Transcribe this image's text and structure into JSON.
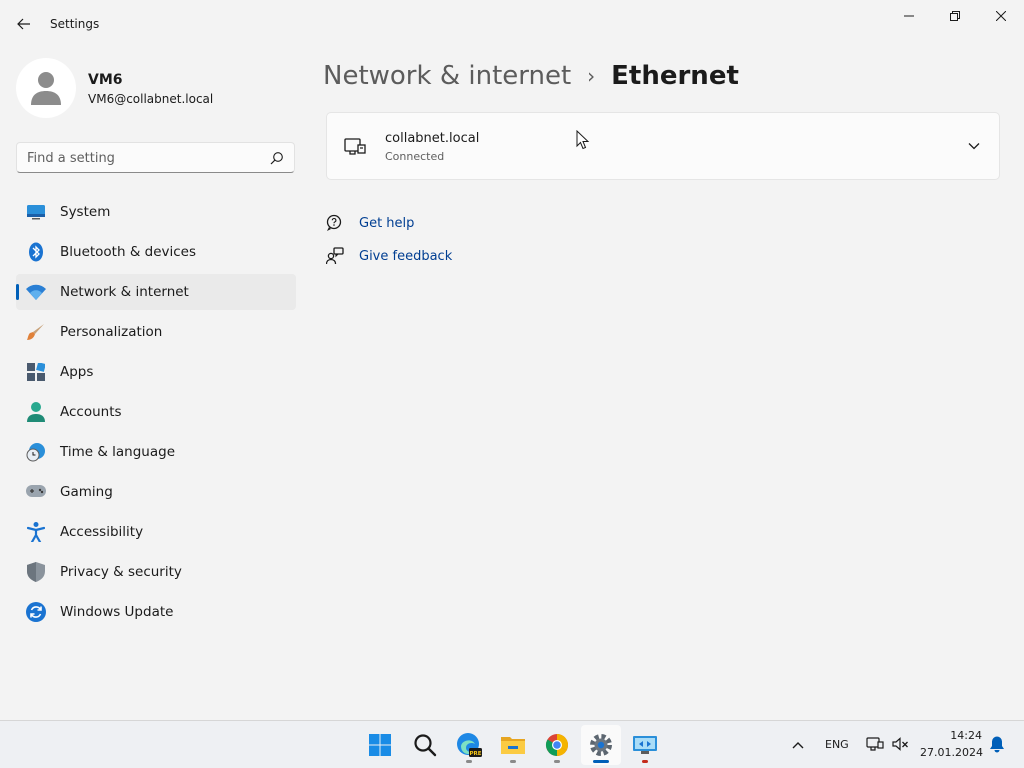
{
  "app": {
    "title": "Settings"
  },
  "profile": {
    "name": "VM6",
    "email": "VM6@collabnet.local"
  },
  "search": {
    "placeholder": "Find a setting"
  },
  "sidebar": {
    "items": [
      {
        "label": "System",
        "icon": "monitor-icon"
      },
      {
        "label": "Bluetooth & devices",
        "icon": "bluetooth-icon"
      },
      {
        "label": "Network & internet",
        "icon": "wifi-icon",
        "active": true
      },
      {
        "label": "Personalization",
        "icon": "brush-icon"
      },
      {
        "label": "Apps",
        "icon": "apps-icon"
      },
      {
        "label": "Accounts",
        "icon": "person-icon"
      },
      {
        "label": "Time & language",
        "icon": "globe-clock-icon"
      },
      {
        "label": "Gaming",
        "icon": "gamepad-icon"
      },
      {
        "label": "Accessibility",
        "icon": "accessibility-icon"
      },
      {
        "label": "Privacy & security",
        "icon": "shield-icon"
      },
      {
        "label": "Windows Update",
        "icon": "update-icon"
      }
    ]
  },
  "breadcrumb": {
    "parent": "Network & internet",
    "separator": "›",
    "current": "Ethernet"
  },
  "ethernet_card": {
    "title": "collabnet.local",
    "status": "Connected"
  },
  "links": {
    "help": "Get help",
    "feedback": "Give feedback"
  },
  "taskbar": {
    "apps": [
      "windows-start-icon",
      "search-icon",
      "edge-preview-icon",
      "file-explorer-icon",
      "chrome-icon",
      "settings-icon",
      "remote-desktop-icon"
    ],
    "tray": {
      "language": "ENG",
      "time": "14:24",
      "date": "27.01.2024"
    }
  },
  "colors": {
    "accent": "#005fb8",
    "link": "#003e92",
    "background": "#f3f3f3"
  }
}
